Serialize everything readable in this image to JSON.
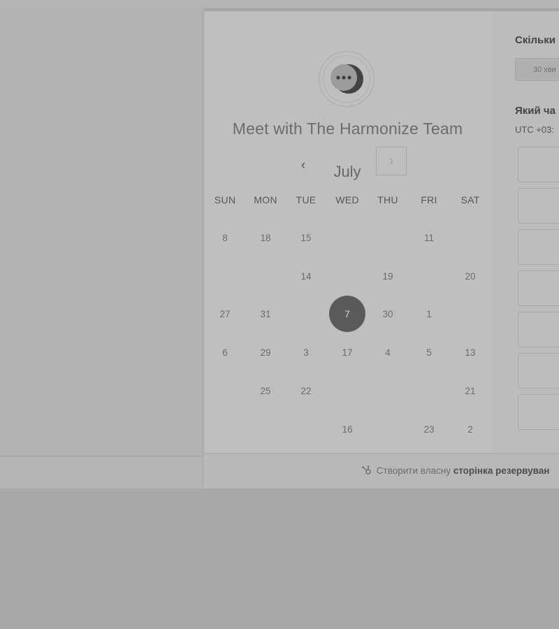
{
  "calendar": {
    "title": "Meet with The Harmonize Team",
    "month": "July",
    "prev_label": "‹",
    "next_label": "›",
    "weekdays": [
      "SUN",
      "MON",
      "TUE",
      "WED",
      "THU",
      "FRI",
      "SAT"
    ],
    "days": [
      {
        "label": "8",
        "col": 0,
        "row": 0
      },
      {
        "label": "18",
        "col": 1,
        "row": 0
      },
      {
        "label": "15",
        "col": 2,
        "row": 0
      },
      {
        "label": "11",
        "col": 5,
        "row": 0
      },
      {
        "label": "14",
        "col": 2,
        "row": 1
      },
      {
        "label": "19",
        "col": 4,
        "row": 1
      },
      {
        "label": "20",
        "col": 6,
        "row": 1
      },
      {
        "label": "27",
        "col": 0,
        "row": 2
      },
      {
        "label": "31",
        "col": 1,
        "row": 2
      },
      {
        "label": "7",
        "col": 3,
        "row": 2,
        "selected": true
      },
      {
        "label": "30",
        "col": 4,
        "row": 2
      },
      {
        "label": "1",
        "col": 5,
        "row": 2
      },
      {
        "label": "6",
        "col": 0,
        "row": 3
      },
      {
        "label": "29",
        "col": 1,
        "row": 3
      },
      {
        "label": "3",
        "col": 2,
        "row": 3
      },
      {
        "label": "17",
        "col": 3,
        "row": 3
      },
      {
        "label": "4",
        "col": 4,
        "row": 3
      },
      {
        "label": "5",
        "col": 5,
        "row": 3
      },
      {
        "label": "13",
        "col": 6,
        "row": 3
      },
      {
        "label": "25",
        "col": 1,
        "row": 4
      },
      {
        "label": "22",
        "col": 2,
        "row": 4
      },
      {
        "label": "21",
        "col": 6,
        "row": 4
      },
      {
        "label": "16",
        "col": 3,
        "row": 5
      },
      {
        "label": "23",
        "col": 5,
        "row": 5
      },
      {
        "label": "2",
        "col": 6,
        "row": 5
      }
    ]
  },
  "booking": {
    "duration_question": "Скільки",
    "duration_option": "30 хви",
    "time_question": "Який ча",
    "timezone": "UTC +03:",
    "slot_count": 7
  },
  "footer": {
    "prefix": "Створити власну",
    "bold": "сторінка резервуван"
  },
  "colors": {
    "background": "#a9a9a9",
    "panel": "#bfbfbf",
    "selected_day": "#5a5a5a"
  }
}
